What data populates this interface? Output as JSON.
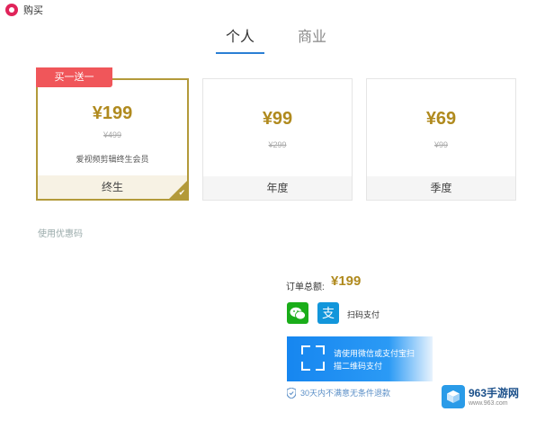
{
  "window": {
    "title": "购买",
    "icon": "app-logo-icon"
  },
  "tabs": [
    {
      "label": "个人",
      "active": true
    },
    {
      "label": "商业",
      "active": false
    }
  ],
  "plans": [
    {
      "promo": "买一送一",
      "price": "¥199",
      "original": "¥499",
      "desc": "爱视频剪辑终生会员",
      "name": "终生",
      "selected": true
    },
    {
      "price": "¥99",
      "original": "¥299",
      "name": "年度",
      "selected": false
    },
    {
      "price": "¥69",
      "original": "¥99",
      "name": "季度",
      "selected": false
    }
  ],
  "coupon_label": "使用优惠码",
  "order": {
    "total_label": "订单总额:",
    "total_value": "¥199"
  },
  "payment": {
    "wechat_icon": "wechat-pay-icon",
    "alipay_icon": "alipay-icon",
    "scan_label": "扫码支付"
  },
  "qr": {
    "line1": "请使用微信或支付宝扫",
    "line2": "描二维码支付"
  },
  "guarantee": "30天内不满意无条件退款",
  "watermark": {
    "main": "963手游网",
    "url": "www.963.com"
  },
  "colors": {
    "accent": "#2a7fd4",
    "gold": "#b08a1e",
    "promo": "#f0565a",
    "wechat": "#1aad19",
    "alipay": "#1296db"
  }
}
